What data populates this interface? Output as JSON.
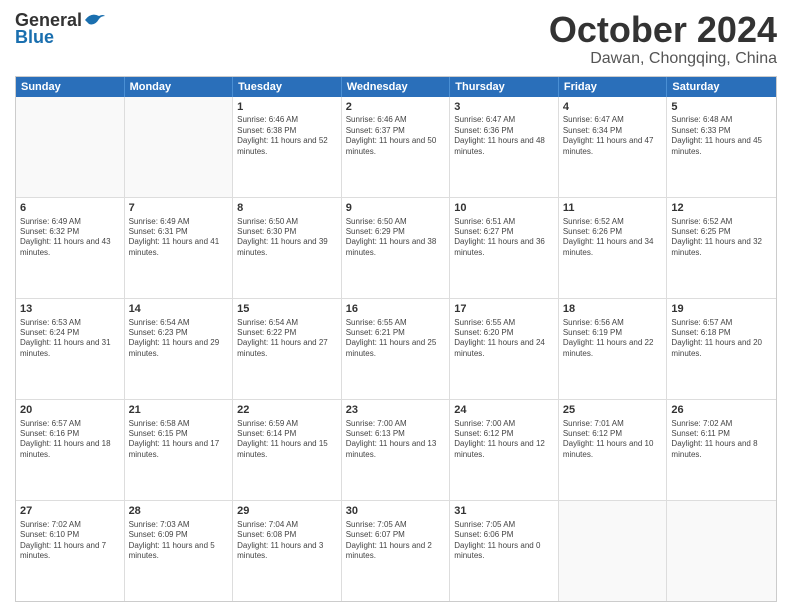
{
  "header": {
    "logo_general": "General",
    "logo_blue": "Blue",
    "month_title": "October 2024",
    "location": "Dawan, Chongqing, China"
  },
  "weekdays": [
    "Sunday",
    "Monday",
    "Tuesday",
    "Wednesday",
    "Thursday",
    "Friday",
    "Saturday"
  ],
  "rows": [
    [
      {
        "day": "",
        "sunrise": "",
        "sunset": "",
        "daylight": "",
        "empty": true
      },
      {
        "day": "",
        "sunrise": "",
        "sunset": "",
        "daylight": "",
        "empty": true
      },
      {
        "day": "1",
        "sunrise": "Sunrise: 6:46 AM",
        "sunset": "Sunset: 6:38 PM",
        "daylight": "Daylight: 11 hours and 52 minutes."
      },
      {
        "day": "2",
        "sunrise": "Sunrise: 6:46 AM",
        "sunset": "Sunset: 6:37 PM",
        "daylight": "Daylight: 11 hours and 50 minutes."
      },
      {
        "day": "3",
        "sunrise": "Sunrise: 6:47 AM",
        "sunset": "Sunset: 6:36 PM",
        "daylight": "Daylight: 11 hours and 48 minutes."
      },
      {
        "day": "4",
        "sunrise": "Sunrise: 6:47 AM",
        "sunset": "Sunset: 6:34 PM",
        "daylight": "Daylight: 11 hours and 47 minutes."
      },
      {
        "day": "5",
        "sunrise": "Sunrise: 6:48 AM",
        "sunset": "Sunset: 6:33 PM",
        "daylight": "Daylight: 11 hours and 45 minutes."
      }
    ],
    [
      {
        "day": "6",
        "sunrise": "Sunrise: 6:49 AM",
        "sunset": "Sunset: 6:32 PM",
        "daylight": "Daylight: 11 hours and 43 minutes."
      },
      {
        "day": "7",
        "sunrise": "Sunrise: 6:49 AM",
        "sunset": "Sunset: 6:31 PM",
        "daylight": "Daylight: 11 hours and 41 minutes."
      },
      {
        "day": "8",
        "sunrise": "Sunrise: 6:50 AM",
        "sunset": "Sunset: 6:30 PM",
        "daylight": "Daylight: 11 hours and 39 minutes."
      },
      {
        "day": "9",
        "sunrise": "Sunrise: 6:50 AM",
        "sunset": "Sunset: 6:29 PM",
        "daylight": "Daylight: 11 hours and 38 minutes."
      },
      {
        "day": "10",
        "sunrise": "Sunrise: 6:51 AM",
        "sunset": "Sunset: 6:27 PM",
        "daylight": "Daylight: 11 hours and 36 minutes."
      },
      {
        "day": "11",
        "sunrise": "Sunrise: 6:52 AM",
        "sunset": "Sunset: 6:26 PM",
        "daylight": "Daylight: 11 hours and 34 minutes."
      },
      {
        "day": "12",
        "sunrise": "Sunrise: 6:52 AM",
        "sunset": "Sunset: 6:25 PM",
        "daylight": "Daylight: 11 hours and 32 minutes."
      }
    ],
    [
      {
        "day": "13",
        "sunrise": "Sunrise: 6:53 AM",
        "sunset": "Sunset: 6:24 PM",
        "daylight": "Daylight: 11 hours and 31 minutes."
      },
      {
        "day": "14",
        "sunrise": "Sunrise: 6:54 AM",
        "sunset": "Sunset: 6:23 PM",
        "daylight": "Daylight: 11 hours and 29 minutes."
      },
      {
        "day": "15",
        "sunrise": "Sunrise: 6:54 AM",
        "sunset": "Sunset: 6:22 PM",
        "daylight": "Daylight: 11 hours and 27 minutes."
      },
      {
        "day": "16",
        "sunrise": "Sunrise: 6:55 AM",
        "sunset": "Sunset: 6:21 PM",
        "daylight": "Daylight: 11 hours and 25 minutes."
      },
      {
        "day": "17",
        "sunrise": "Sunrise: 6:55 AM",
        "sunset": "Sunset: 6:20 PM",
        "daylight": "Daylight: 11 hours and 24 minutes."
      },
      {
        "day": "18",
        "sunrise": "Sunrise: 6:56 AM",
        "sunset": "Sunset: 6:19 PM",
        "daylight": "Daylight: 11 hours and 22 minutes."
      },
      {
        "day": "19",
        "sunrise": "Sunrise: 6:57 AM",
        "sunset": "Sunset: 6:18 PM",
        "daylight": "Daylight: 11 hours and 20 minutes."
      }
    ],
    [
      {
        "day": "20",
        "sunrise": "Sunrise: 6:57 AM",
        "sunset": "Sunset: 6:16 PM",
        "daylight": "Daylight: 11 hours and 18 minutes."
      },
      {
        "day": "21",
        "sunrise": "Sunrise: 6:58 AM",
        "sunset": "Sunset: 6:15 PM",
        "daylight": "Daylight: 11 hours and 17 minutes."
      },
      {
        "day": "22",
        "sunrise": "Sunrise: 6:59 AM",
        "sunset": "Sunset: 6:14 PM",
        "daylight": "Daylight: 11 hours and 15 minutes."
      },
      {
        "day": "23",
        "sunrise": "Sunrise: 7:00 AM",
        "sunset": "Sunset: 6:13 PM",
        "daylight": "Daylight: 11 hours and 13 minutes."
      },
      {
        "day": "24",
        "sunrise": "Sunrise: 7:00 AM",
        "sunset": "Sunset: 6:12 PM",
        "daylight": "Daylight: 11 hours and 12 minutes."
      },
      {
        "day": "25",
        "sunrise": "Sunrise: 7:01 AM",
        "sunset": "Sunset: 6:12 PM",
        "daylight": "Daylight: 11 hours and 10 minutes."
      },
      {
        "day": "26",
        "sunrise": "Sunrise: 7:02 AM",
        "sunset": "Sunset: 6:11 PM",
        "daylight": "Daylight: 11 hours and 8 minutes."
      }
    ],
    [
      {
        "day": "27",
        "sunrise": "Sunrise: 7:02 AM",
        "sunset": "Sunset: 6:10 PM",
        "daylight": "Daylight: 11 hours and 7 minutes."
      },
      {
        "day": "28",
        "sunrise": "Sunrise: 7:03 AM",
        "sunset": "Sunset: 6:09 PM",
        "daylight": "Daylight: 11 hours and 5 minutes."
      },
      {
        "day": "29",
        "sunrise": "Sunrise: 7:04 AM",
        "sunset": "Sunset: 6:08 PM",
        "daylight": "Daylight: 11 hours and 3 minutes."
      },
      {
        "day": "30",
        "sunrise": "Sunrise: 7:05 AM",
        "sunset": "Sunset: 6:07 PM",
        "daylight": "Daylight: 11 hours and 2 minutes."
      },
      {
        "day": "31",
        "sunrise": "Sunrise: 7:05 AM",
        "sunset": "Sunset: 6:06 PM",
        "daylight": "Daylight: 11 hours and 0 minutes."
      },
      {
        "day": "",
        "sunrise": "",
        "sunset": "",
        "daylight": "",
        "empty": true
      },
      {
        "day": "",
        "sunrise": "",
        "sunset": "",
        "daylight": "",
        "empty": true
      }
    ]
  ]
}
